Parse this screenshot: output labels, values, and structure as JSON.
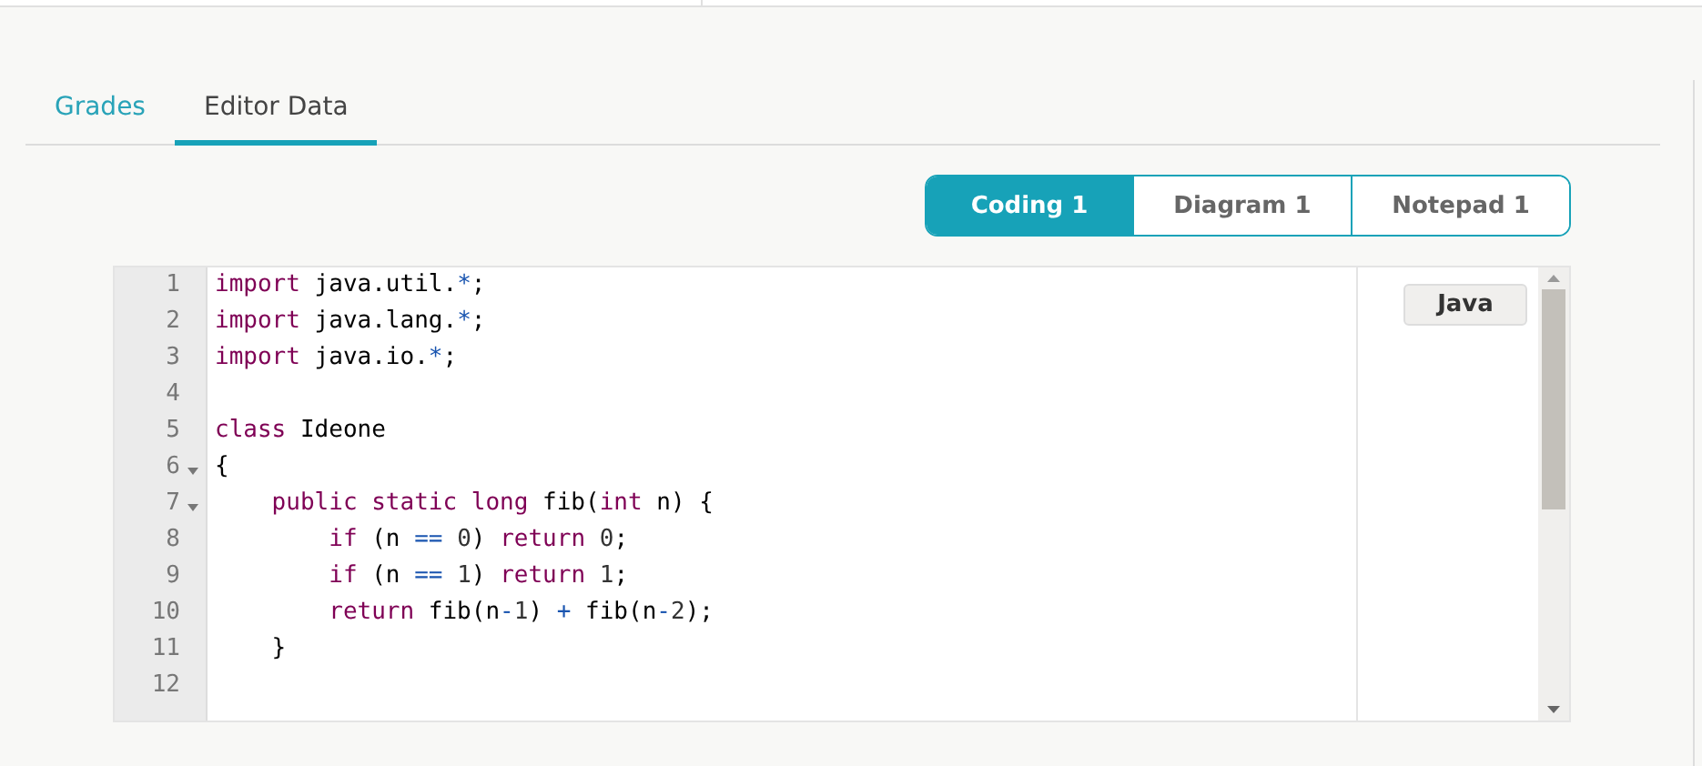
{
  "tabs": [
    {
      "label": "Grades",
      "selected": false
    },
    {
      "label": "Editor Data",
      "selected": true
    }
  ],
  "views": [
    {
      "label": "Coding 1",
      "selected": true
    },
    {
      "label": "Diagram 1",
      "selected": false
    },
    {
      "label": "Notepad 1",
      "selected": false
    }
  ],
  "editor": {
    "language": "Java",
    "lines": [
      {
        "number": "1",
        "foldable": false,
        "tokens": [
          {
            "text": "import",
            "kind": "keyword"
          },
          {
            "text": " java.util.",
            "kind": "plain"
          },
          {
            "text": "*",
            "kind": "operator"
          },
          {
            "text": ";",
            "kind": "plain"
          }
        ]
      },
      {
        "number": "2",
        "foldable": false,
        "tokens": [
          {
            "text": "import",
            "kind": "keyword"
          },
          {
            "text": " java.lang.",
            "kind": "plain"
          },
          {
            "text": "*",
            "kind": "operator"
          },
          {
            "text": ";",
            "kind": "plain"
          }
        ]
      },
      {
        "number": "3",
        "foldable": false,
        "tokens": [
          {
            "text": "import",
            "kind": "keyword"
          },
          {
            "text": " java.io.",
            "kind": "plain"
          },
          {
            "text": "*",
            "kind": "operator"
          },
          {
            "text": ";",
            "kind": "plain"
          }
        ]
      },
      {
        "number": "4",
        "foldable": false
      },
      {
        "number": "5",
        "foldable": false,
        "tokens": [
          {
            "text": "class",
            "kind": "keyword"
          },
          {
            "text": " Ideone",
            "kind": "plain"
          }
        ]
      },
      {
        "number": "6",
        "foldable": true,
        "tokens": [
          {
            "text": "{",
            "kind": "plain"
          }
        ]
      },
      {
        "number": "7",
        "foldable": true,
        "tokens": [
          {
            "text": "    public static long",
            "kind": "keyword"
          },
          {
            "text": " fib(",
            "kind": "plain"
          },
          {
            "text": "int",
            "kind": "keyword"
          },
          {
            "text": " n) {",
            "kind": "plain"
          }
        ]
      },
      {
        "number": "8",
        "foldable": false,
        "tokens": [
          {
            "text": "        if",
            "kind": "keyword"
          },
          {
            "text": " (n ",
            "kind": "plain"
          },
          {
            "text": "==",
            "kind": "operator"
          },
          {
            "text": " 0",
            "kind": "number"
          },
          {
            "text": ") ",
            "kind": "plain"
          },
          {
            "text": "return",
            "kind": "keyword"
          },
          {
            "text": " 0",
            "kind": "number"
          },
          {
            "text": ";",
            "kind": "plain"
          }
        ]
      },
      {
        "number": "9",
        "foldable": false,
        "tokens": [
          {
            "text": "        if",
            "kind": "keyword"
          },
          {
            "text": " (n ",
            "kind": "plain"
          },
          {
            "text": "==",
            "kind": "operator"
          },
          {
            "text": " 1",
            "kind": "number"
          },
          {
            "text": ") ",
            "kind": "plain"
          },
          {
            "text": "return",
            "kind": "keyword"
          },
          {
            "text": " 1",
            "kind": "number"
          },
          {
            "text": ";",
            "kind": "plain"
          }
        ]
      },
      {
        "number": "10",
        "foldable": false,
        "tokens": [
          {
            "text": "        return",
            "kind": "keyword"
          },
          {
            "text": " fib(n",
            "kind": "plain"
          },
          {
            "text": "-",
            "kind": "operator"
          },
          {
            "text": "1",
            "kind": "number"
          },
          {
            "text": ") ",
            "kind": "plain"
          },
          {
            "text": "+",
            "kind": "operator"
          },
          {
            "text": " fib(n",
            "kind": "plain"
          },
          {
            "text": "-",
            "kind": "operator"
          },
          {
            "text": "2",
            "kind": "number"
          },
          {
            "text": ");",
            "kind": "plain"
          }
        ]
      },
      {
        "number": "11",
        "foldable": false,
        "tokens": [
          {
            "text": "    }",
            "kind": "plain"
          }
        ]
      },
      {
        "number": "12",
        "foldable": false
      }
    ]
  }
}
